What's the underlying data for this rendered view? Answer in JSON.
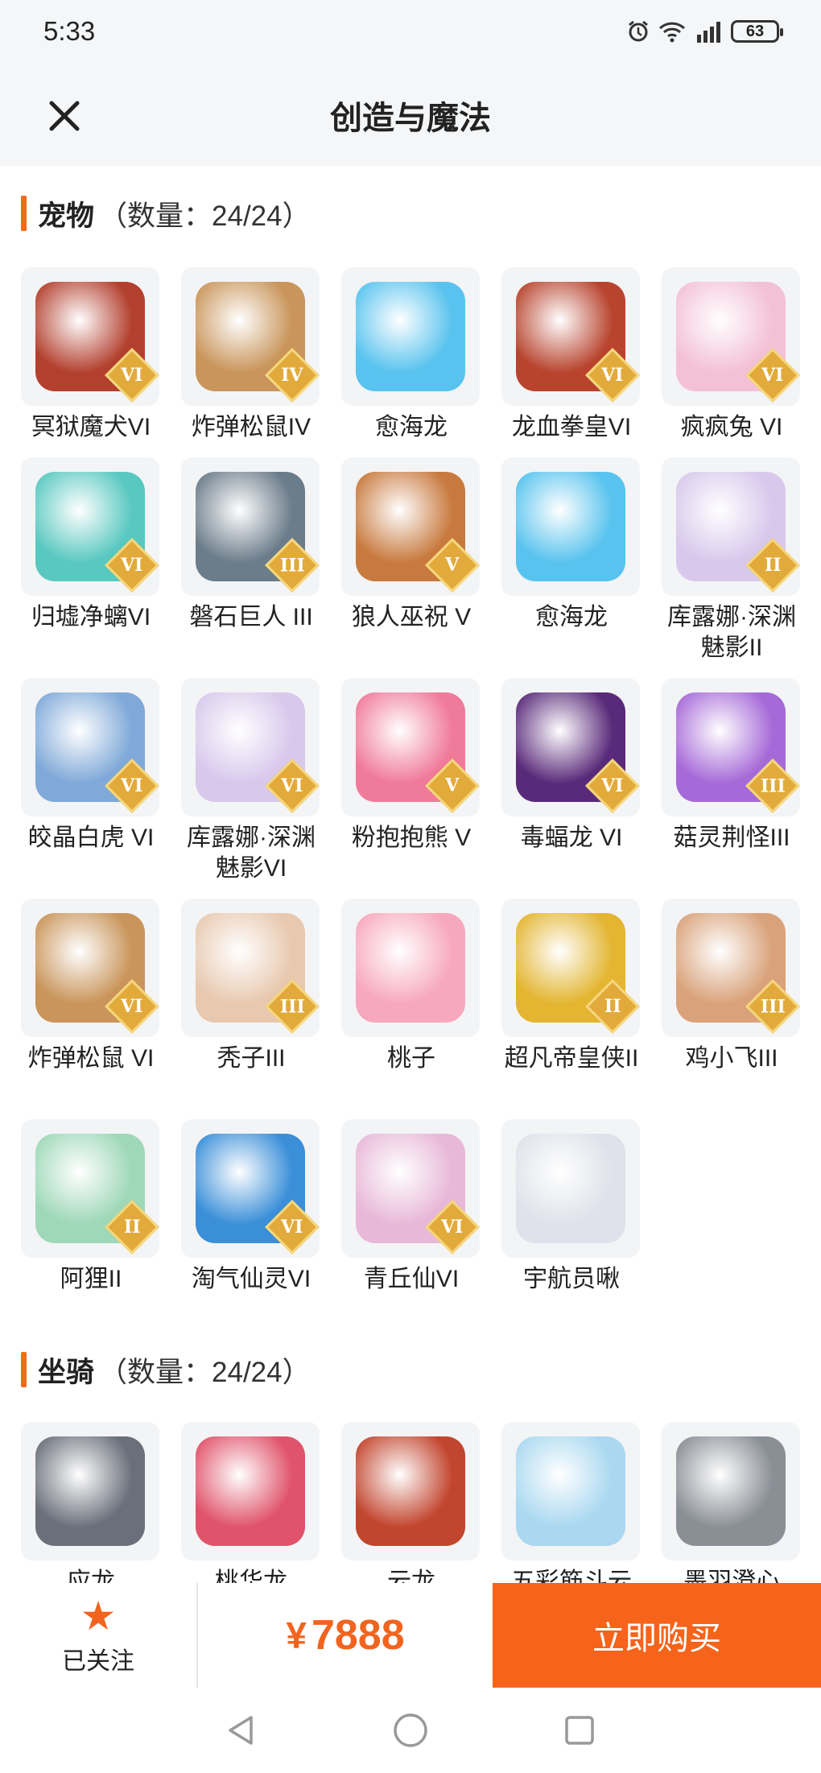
{
  "status": {
    "time": "5:33",
    "battery": "63",
    "network": "4G",
    "signal_super": "6"
  },
  "header": {
    "title": "创造与魔法"
  },
  "sections": [
    {
      "title": "宠物",
      "count": "（数量：24/24）",
      "items": [
        {
          "name": "冥狱魔犬VI",
          "rank": "VI",
          "color": "#b3402f"
        },
        {
          "name": "炸弹松鼠IV",
          "rank": "IV",
          "color": "#c9955a"
        },
        {
          "name": "愈海龙",
          "rank": "",
          "color": "#58c3ee"
        },
        {
          "name": "龙血拳皇VI",
          "rank": "VI",
          "color": "#b8442e"
        },
        {
          "name": "疯疯兔 VI",
          "rank": "VI",
          "color": "#f3c1d6"
        },
        {
          "name": "归墟净螭VI",
          "rank": "VI",
          "color": "#58c8c0"
        },
        {
          "name": "磐石巨人 III",
          "rank": "III",
          "color": "#6b7c8a"
        },
        {
          "name": "狼人巫祝 V",
          "rank": "V",
          "color": "#c87a3e"
        },
        {
          "name": "愈海龙",
          "rank": "",
          "color": "#58c3ee"
        },
        {
          "name": "库露娜·深渊魅影II",
          "rank": "II",
          "color": "#d8c8ec"
        },
        {
          "name": "皎晶白虎 VI",
          "rank": "VI",
          "color": "#7fa9d8"
        },
        {
          "name": "库露娜·深渊魅影VI",
          "rank": "VI",
          "color": "#d8c8ec"
        },
        {
          "name": "粉抱抱熊 V",
          "rank": "V",
          "color": "#f07a9a"
        },
        {
          "name": "毒蝠龙 VI",
          "rank": "VI",
          "color": "#5a2a7a"
        },
        {
          "name": "菇灵荆怪III",
          "rank": "III",
          "color": "#a66ad8"
        },
        {
          "name": "炸弹松鼠 VI",
          "rank": "VI",
          "color": "#c9955a"
        },
        {
          "name": "秃子III",
          "rank": "III",
          "color": "#e8c9b0"
        },
        {
          "name": "桃子",
          "rank": "",
          "color": "#f7a8be"
        },
        {
          "name": "超凡帝皇侠II",
          "rank": "II",
          "color": "#e3b530"
        },
        {
          "name": "鸡小飞III",
          "rank": "III",
          "color": "#d9a27a"
        },
        {
          "name": "阿狸II",
          "rank": "II",
          "color": "#9ed8b8"
        },
        {
          "name": "淘气仙灵VI",
          "rank": "VI",
          "color": "#3a8fd8"
        },
        {
          "name": "青丘仙VI",
          "rank": "VI",
          "color": "#e8b8d8"
        },
        {
          "name": "宇航员啾",
          "rank": "",
          "color": "#dfe2ea"
        }
      ]
    },
    {
      "title": "坐骑",
      "count": "（数量：24/24）",
      "items": [
        {
          "name": "应龙",
          "rank": "",
          "color": "#6a6f7a"
        },
        {
          "name": "桃华龙",
          "rank": "",
          "color": "#e0536a"
        },
        {
          "name": "云龙",
          "rank": "",
          "color": "#c2452e"
        },
        {
          "name": "五彩筋斗云",
          "rank": "",
          "color": "#a9d8f0"
        },
        {
          "name": "墨羽澄心",
          "rank": "",
          "color": "#8a8f96"
        }
      ]
    }
  ],
  "footer": {
    "follow_label": "已关注",
    "price_symbol": "¥",
    "price": "7888",
    "buy_label": "立即购买"
  }
}
